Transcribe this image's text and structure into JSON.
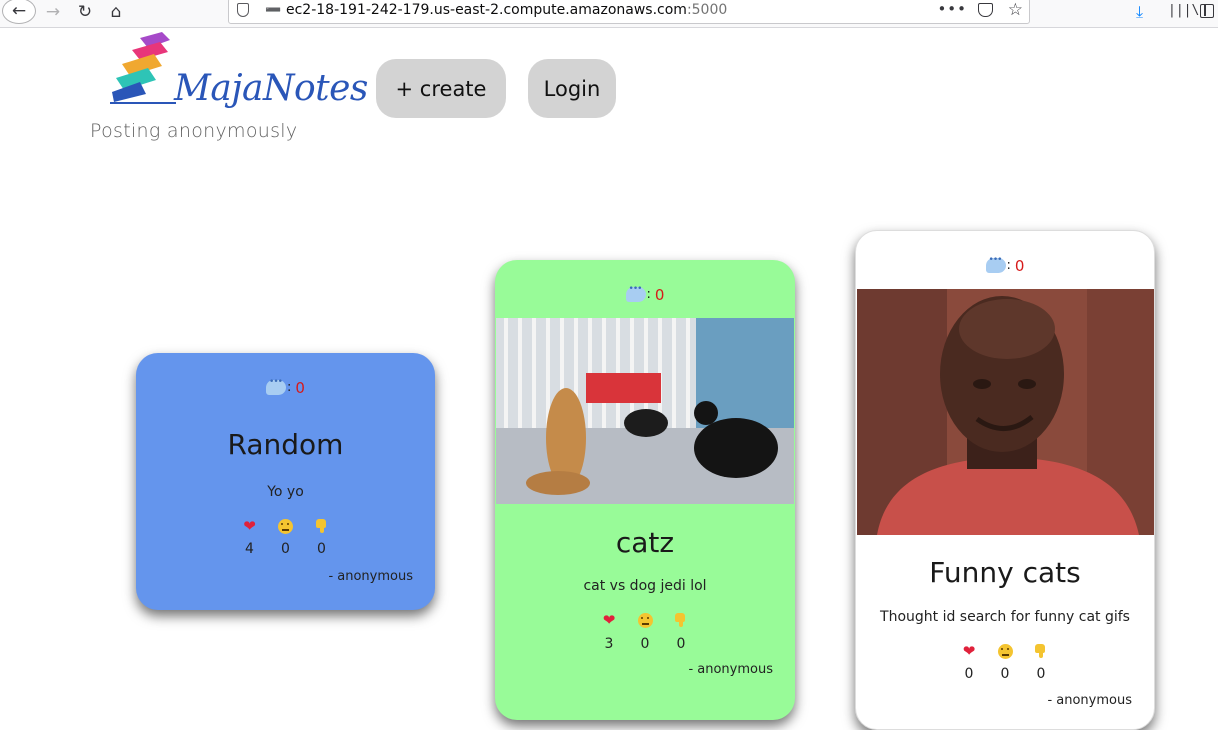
{
  "browser": {
    "url_host": "ec2-18-191-242-179.us-east-2.compute.amazonaws.com",
    "url_port": ":5000",
    "icons": [
      "back-icon",
      "forward-icon",
      "reload-icon",
      "home-icon",
      "shield-icon",
      "insecure-lock-icon",
      "page-actions-icon",
      "pocket-icon",
      "bookmark-star-icon",
      "download-icon",
      "library-icon",
      "sidebar-icon"
    ]
  },
  "header": {
    "brand": "MajaNotes",
    "tagline": "Posting anonymously",
    "create_label": "+ create",
    "login_label": "Login"
  },
  "colors": {
    "card_blue": "#6495ed",
    "card_green": "#98fb98",
    "card_white": "#ffffff",
    "comment_count": "#d61a1a",
    "button_bg": "#d3d3d3"
  },
  "notes": [
    {
      "comment_separator": ":",
      "comment_count": "0",
      "title": "Random",
      "body": "Yo yo",
      "reactions": {
        "love": "4",
        "neutral": "0",
        "dislike": "0"
      },
      "author": "- anonymous"
    },
    {
      "comment_separator": ":",
      "comment_count": "0",
      "title": "catz",
      "body": "cat vs dog jedi lol",
      "reactions": {
        "love": "3",
        "neutral": "0",
        "dislike": "0"
      },
      "author": "- anonymous"
    },
    {
      "comment_separator": ":",
      "comment_count": "0",
      "title": "Funny cats",
      "body": "Thought id search for funny cat gifs",
      "reactions": {
        "love": "0",
        "neutral": "0",
        "dislike": "0"
      },
      "author": "- anonymous"
    }
  ]
}
